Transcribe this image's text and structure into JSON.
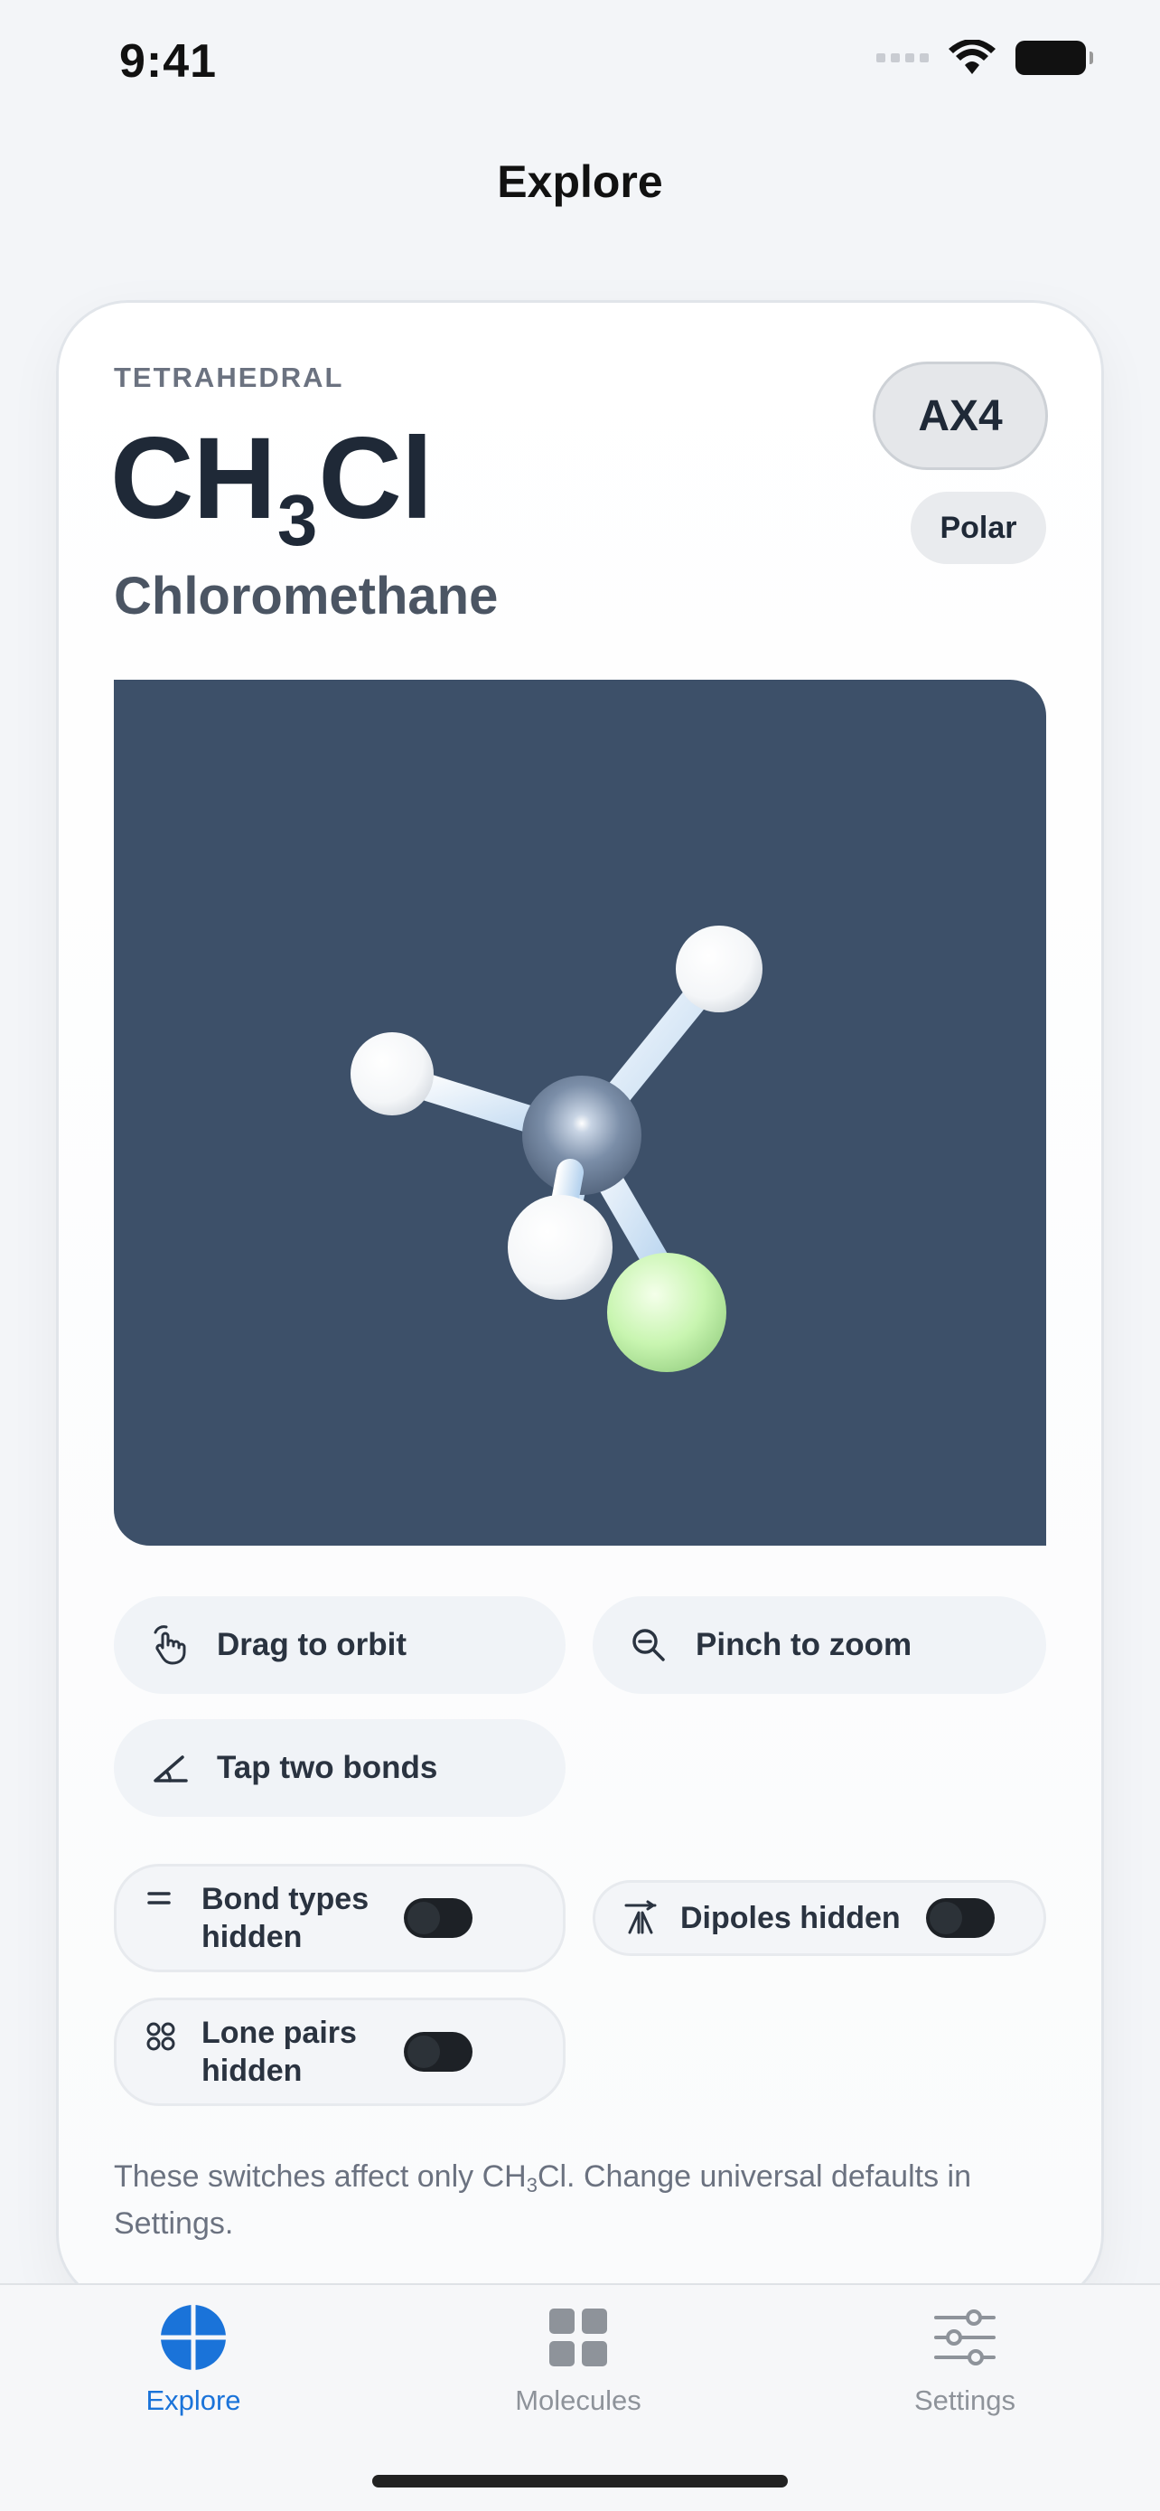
{
  "status_bar": {
    "time": "9:41"
  },
  "nav": {
    "title": "Explore"
  },
  "molecule": {
    "geometry": "TETRAHEDRAL",
    "formula_parts": [
      "CH",
      "3",
      "Cl"
    ],
    "name": "Chloromethane",
    "axe_notation": "AX4",
    "polarity": "Polar"
  },
  "hints": {
    "orbit": "Drag to orbit",
    "zoom": "Pinch to zoom",
    "bonds": "Tap two bonds"
  },
  "toggles": {
    "bond_types": "Bond types hidden",
    "dipoles": "Dipoles hidden",
    "lone_pairs": "Lone pairs hidden"
  },
  "footnote": {
    "before": "These switches affect only CH",
    "sub": "3",
    "after": "Cl. Change universal defaults in Settings."
  },
  "tabs": [
    {
      "label": "Explore",
      "active": true
    },
    {
      "label": "Molecules",
      "active": false
    },
    {
      "label": "Settings",
      "active": false
    }
  ],
  "colors": {
    "accent": "#1a73d9",
    "viewport_bg": "#3d5069",
    "carbon": "#7b8ea8",
    "hydrogen": "#ffffff",
    "chlorine": "#c8f5b0"
  }
}
